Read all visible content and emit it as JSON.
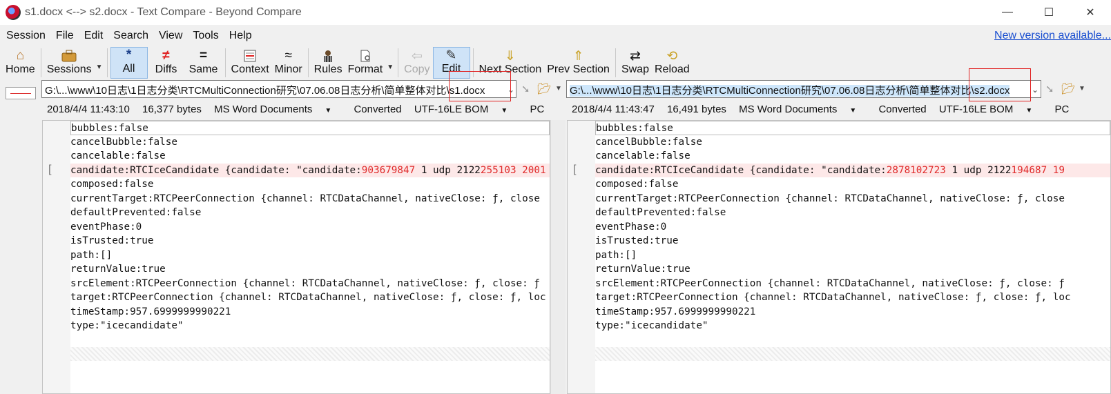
{
  "window": {
    "title": "s1.docx <--> s2.docx - Text Compare - Beyond Compare",
    "minimize": "—",
    "maximize": "☐",
    "close": "✕"
  },
  "menu": {
    "items": [
      "Session",
      "File",
      "Edit",
      "Search",
      "View",
      "Tools",
      "Help"
    ],
    "new_version": "New version available..."
  },
  "toolbar": {
    "home": "Home",
    "sessions": "Sessions",
    "all": "All",
    "diffs": "Diffs",
    "same": "Same",
    "context": "Context",
    "minor": "Minor",
    "rules": "Rules",
    "format": "Format",
    "copy": "Copy",
    "edit": "Edit",
    "next_section": "Next Section",
    "prev_section": "Prev Section",
    "swap": "Swap",
    "reload": "Reload"
  },
  "left": {
    "path": "G:\\...\\www\\10日志\\1日志分类\\RTCMultiConnection研究\\07.06.08日志分析\\简单整体对比\\s1.docx",
    "date": "2018/4/4 11:43:10",
    "size": "16,377 bytes",
    "format": "MS Word Documents",
    "status": "Converted",
    "encoding": "UTF-16LE BOM",
    "lineend": "PC",
    "cand_prefix": "candidate:RTCIceCandidate {candidate: \"candidate:",
    "cand_id": "903679847",
    "cand_mid": " 1 udp 2122",
    "cand_tail": "255103 2001"
  },
  "right": {
    "path": "G:\\...\\www\\10日志\\1日志分类\\RTCMultiConnection研究\\07.06.08日志分析\\简单整体对比\\s2.docx",
    "date": "2018/4/4 11:43:47",
    "size": "16,491 bytes",
    "format": "MS Word Documents",
    "status": "Converted",
    "encoding": "UTF-16LE BOM",
    "lineend": "PC",
    "cand_prefix": "candidate:RTCIceCandidate {candidate: \"candidate:",
    "cand_id": "2878102723",
    "cand_mid": " 1 udp 2122",
    "cand_tail": "194687 19"
  },
  "lines": {
    "l1": "bubbles:false",
    "l2": "cancelBubble:false",
    "l3": "cancelable:false",
    "l5": "composed:false",
    "l6": "currentTarget:RTCPeerConnection {channel: RTCDataChannel, nativeClose: ƒ, close",
    "l7": "defaultPrevented:false",
    "l8": "eventPhase:0",
    "l9": "isTrusted:true",
    "l10": "path:[]",
    "l11": "returnValue:true",
    "l12": "srcElement:RTCPeerConnection {channel: RTCDataChannel, nativeClose: ƒ, close: ƒ",
    "l13": "target:RTCPeerConnection {channel: RTCDataChannel, nativeClose: ƒ, close: ƒ, loc",
    "l14": "timeStamp:957.6999999990221",
    "l15": "type:\"icecandidate\""
  }
}
